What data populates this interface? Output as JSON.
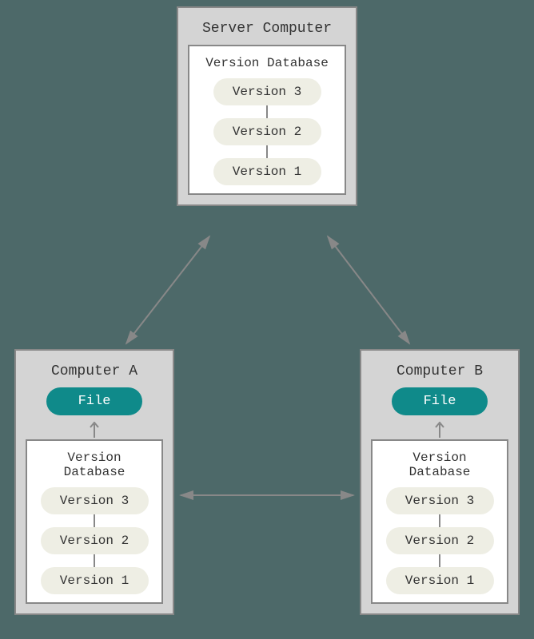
{
  "server": {
    "title": "Server Computer",
    "database": {
      "title": "Version Database",
      "versions": [
        "Version 3",
        "Version 2",
        "Version 1"
      ]
    }
  },
  "computerA": {
    "title": "Computer A",
    "file_label": "File",
    "database": {
      "title": "Version Database",
      "versions": [
        "Version 3",
        "Version 2",
        "Version 1"
      ]
    }
  },
  "computerB": {
    "title": "Computer B",
    "file_label": "File",
    "database": {
      "title": "Version Database",
      "versions": [
        "Version 3",
        "Version 2",
        "Version 1"
      ]
    }
  },
  "colors": {
    "background": "#4d6969",
    "box_fill": "#d4d4d4",
    "border": "#888888",
    "file_pill": "#0f8a8a",
    "version_pill": "#eeeee4",
    "arrow": "#888888"
  }
}
